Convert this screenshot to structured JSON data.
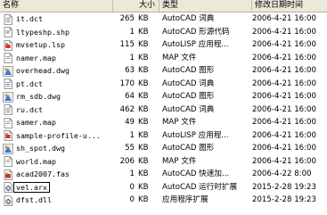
{
  "header": {
    "name": "名称",
    "size": "大小",
    "type": "类型",
    "modified": "修改日期时间"
  },
  "files": [
    {
      "name": "it.dct",
      "size": "265",
      "unit": "KB",
      "type": "AutoCAD 词典",
      "date": "2006-4-21 16:00",
      "icon": "dictionary-file-icon"
    },
    {
      "name": "ltypeshp.shp",
      "size": "1",
      "unit": "KB",
      "type": "AutoCAD 形源代码",
      "date": "2006-4-21 16:00",
      "icon": "shape-source-file-icon"
    },
    {
      "name": "mvsetup.lsp",
      "size": "115",
      "unit": "KB",
      "type": "AutoLISP 应用程...",
      "date": "2006-4-21 16:00",
      "icon": "lisp-file-icon"
    },
    {
      "name": "namer.map",
      "size": "1",
      "unit": "KB",
      "type": "MAP 文件",
      "date": "2006-4-21 16:00",
      "icon": "map-file-icon"
    },
    {
      "name": "overhead.dwg",
      "size": "63",
      "unit": "KB",
      "type": "AutoCAD 图形",
      "date": "2006-4-21 16:00",
      "icon": "dwg-file-icon"
    },
    {
      "name": "pt.dct",
      "size": "170",
      "unit": "KB",
      "type": "AutoCAD 词典",
      "date": "2006-4-21 16:00",
      "icon": "dictionary-file-icon"
    },
    {
      "name": "rm_sdb.dwg",
      "size": "64",
      "unit": "KB",
      "type": "AutoCAD 图形",
      "date": "2006-4-21 16:00",
      "icon": "dwg-file-icon"
    },
    {
      "name": "ru.dct",
      "size": "462",
      "unit": "KB",
      "type": "AutoCAD 词典",
      "date": "2006-4-21 16:00",
      "icon": "dictionary-file-icon"
    },
    {
      "name": "samer.map",
      "size": "49",
      "unit": "KB",
      "type": "MAP 文件",
      "date": "2006-4-21 16:00",
      "icon": "map-file-icon"
    },
    {
      "name": "sample-profile-u...",
      "size": "1",
      "unit": "KB",
      "type": "AutoLISP 应用程...",
      "date": "2006-4-21 16:00",
      "icon": "lisp-file-icon"
    },
    {
      "name": "sh_spot.dwg",
      "size": "55",
      "unit": "KB",
      "type": "AutoCAD 图形",
      "date": "2006-4-21 16:00",
      "icon": "dwg-file-icon"
    },
    {
      "name": "world.map",
      "size": "206",
      "unit": "KB",
      "type": "MAP 文件",
      "date": "2006-4-21 16:00",
      "icon": "map-file-icon"
    },
    {
      "name": "acad2007.fas",
      "size": "1",
      "unit": "KB",
      "type": "AutoCAD 快速加...",
      "date": "2006-4-22 8:00",
      "icon": "fas-file-icon"
    },
    {
      "name": "vel.arx",
      "size": "0",
      "unit": "KB",
      "type": "AutoCAD 运行时扩展",
      "date": "2015-2-28 19:23",
      "icon": "arx-file-icon",
      "selected": true
    },
    {
      "name": "dfst.dll",
      "size": "0",
      "unit": "KB",
      "type": "应用程序扩展",
      "date": "2015-2-28 19:23",
      "icon": "dll-file-icon"
    }
  ],
  "colors": {
    "header_bg": "#ece9d8",
    "selection_outline": "#000000"
  }
}
